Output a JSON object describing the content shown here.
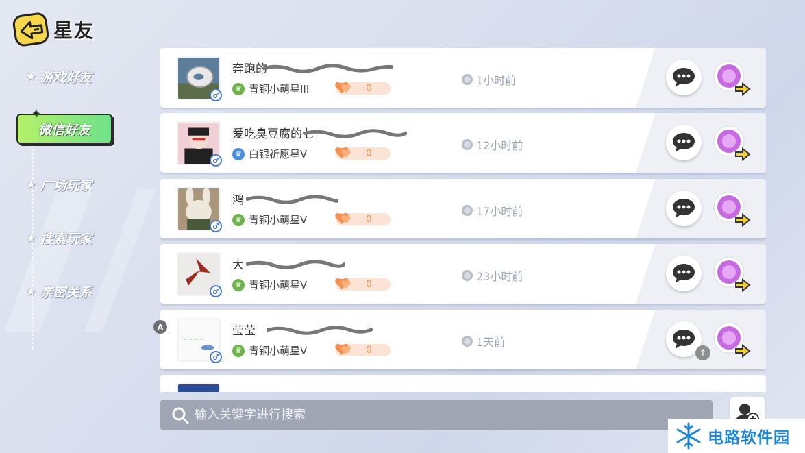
{
  "header": {
    "title": "星友"
  },
  "sidebar": {
    "items": [
      {
        "label": "游戏好友"
      },
      {
        "label": "微信好友",
        "active": true
      },
      {
        "label": "广场玩家"
      },
      {
        "label": "搜索玩家"
      },
      {
        "label": "亲密关系"
      }
    ]
  },
  "friends": [
    {
      "name": "奔跑的",
      "rank": "青铜小萌星III",
      "rank_color": "#6db34a",
      "intimacy": "0",
      "time": "1小时前",
      "gender": "♂"
    },
    {
      "name": "爱吃臭豆腐的七",
      "rank": "白银祈愿星V",
      "rank_color": "#4c8fe0",
      "intimacy": "0",
      "time": "12小时前",
      "gender": "♂"
    },
    {
      "name": "鸿",
      "rank": "青铜小萌星V",
      "rank_color": "#6db34a",
      "intimacy": "0",
      "time": "17小时前",
      "gender": "♂"
    },
    {
      "name": "大",
      "rank": "青铜小萌星V",
      "rank_color": "#6db34a",
      "intimacy": "0",
      "time": "23小时前",
      "gender": "♂"
    },
    {
      "name": "莹莹",
      "rank": "青铜小萌星V",
      "rank_color": "#6db34a",
      "intimacy": "0",
      "time": "1天前",
      "gender": "♂"
    },
    {
      "name": "",
      "rank": "",
      "rank_color": "#6db34a",
      "intimacy": "",
      "time": "",
      "gender": ""
    }
  ],
  "badges": {
    "a": "A",
    "up": "↑"
  },
  "search": {
    "placeholder": "输入关键字进行搜索"
  },
  "watermark": {
    "text": "电路软件园"
  },
  "colors": {
    "accent_green": "#7ee27a",
    "search_bg": "#9fa5b2",
    "intimacy_orange": "#f08a4b"
  },
  "icons": {
    "back": "back-arrow-icon",
    "chat": "chat-icon",
    "gift": "gift-icon",
    "search": "search-icon",
    "add_friend": "add-friend-icon"
  }
}
